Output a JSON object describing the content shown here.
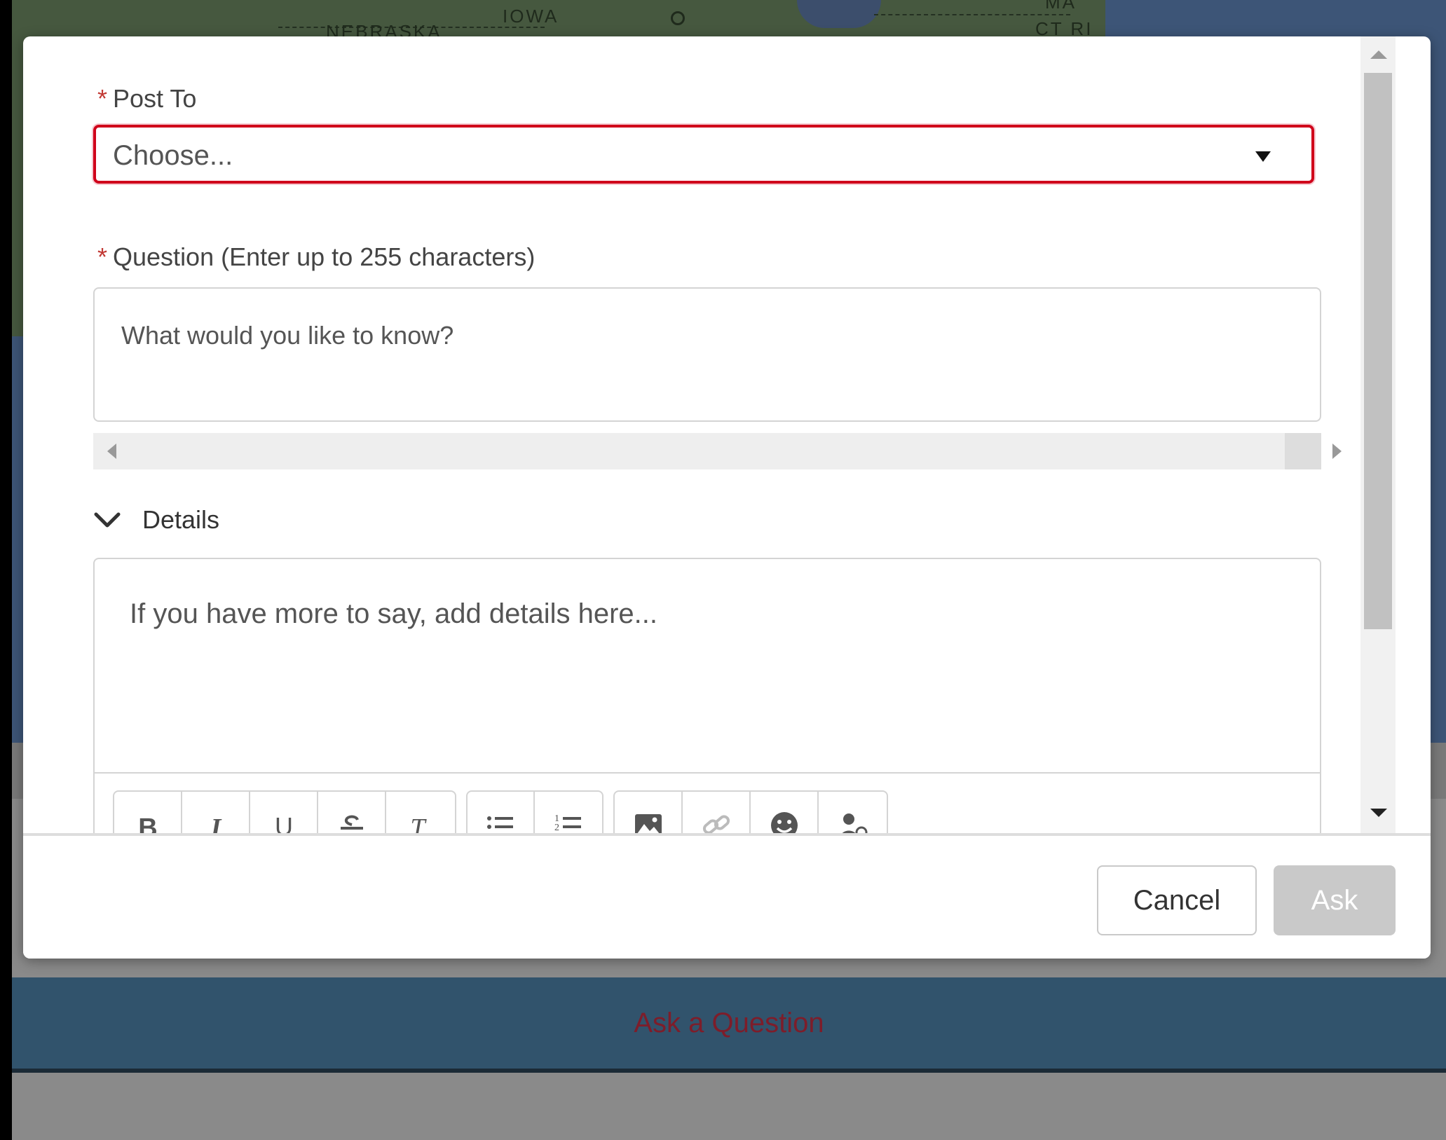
{
  "map": {
    "labels": [
      "IOWA",
      "NEBRASKA",
      "CT RI",
      "MA"
    ]
  },
  "modal": {
    "post_to": {
      "required_mark": "*",
      "label": "Post To",
      "selected": "Choose..."
    },
    "question": {
      "required_mark": "*",
      "label": "Question (Enter up to 255 characters)",
      "placeholder": "What would you like to know?"
    },
    "details": {
      "toggle_label": "Details",
      "placeholder": "If you have more to say, add details here...",
      "toolbar": [
        {
          "group": "text",
          "buttons": [
            {
              "name": "bold-button",
              "glyph": "B",
              "icon": "bold-icon"
            },
            {
              "name": "italic-button",
              "glyph": "I",
              "icon": "italic-icon"
            },
            {
              "name": "underline-button",
              "glyph": "U",
              "icon": "underline-icon"
            },
            {
              "name": "strikethrough-button",
              "glyph": "S",
              "icon": "strikethrough-icon"
            },
            {
              "name": "remove-formatting-button",
              "glyph": "T",
              "icon": "remove-formatting-icon"
            }
          ]
        },
        {
          "group": "list",
          "buttons": [
            {
              "name": "bulleted-list-button",
              "icon": "bulleted-list-icon"
            },
            {
              "name": "numbered-list-button",
              "icon": "numbered-list-icon"
            }
          ]
        },
        {
          "group": "insert",
          "buttons": [
            {
              "name": "insert-image-button",
              "icon": "image-icon"
            },
            {
              "name": "insert-link-button",
              "icon": "link-icon"
            },
            {
              "name": "insert-emoji-button",
              "icon": "emoji-icon"
            },
            {
              "name": "mention-button",
              "icon": "mention-icon"
            }
          ]
        }
      ]
    },
    "footer": {
      "cancel_label": "Cancel",
      "ask_label": "Ask"
    }
  },
  "page": {
    "ask_bar_label": "Ask a Question"
  },
  "colors": {
    "error_border": "#d0021b",
    "required_mark": "#c23934",
    "ask_disabled": "#c9c9c9",
    "ask_bar_bg": "#31536c",
    "ask_bar_text": "#7d1d2a"
  }
}
